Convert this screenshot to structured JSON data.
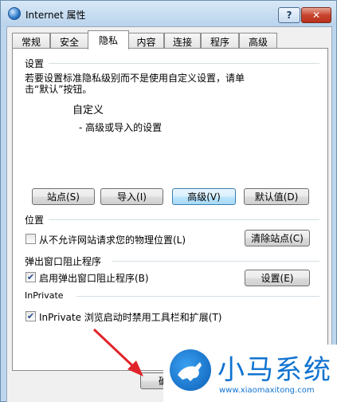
{
  "window": {
    "title": "Internet 属性",
    "help_label": "?",
    "close_label": "✕"
  },
  "tabs": [
    {
      "label": "常规"
    },
    {
      "label": "安全"
    },
    {
      "label": "隐私"
    },
    {
      "label": "内容"
    },
    {
      "label": "连接"
    },
    {
      "label": "程序"
    },
    {
      "label": "高级"
    }
  ],
  "active_tab": "隐私",
  "settings": {
    "heading": "设置",
    "description_line1": "若要设置标准隐私级别而不是使用自定义设置，请单",
    "description_line2": "击“默认”按钮。",
    "level": "自定义",
    "level_detail": "- 高级或导入的设置"
  },
  "settings_buttons": {
    "sites": "站点(S)",
    "import": "导入(I)",
    "advanced": "高级(V)",
    "default": "默认值(D)"
  },
  "location": {
    "heading": "位置",
    "checkbox_label": "从不允许网站请求您的物理位置(L)",
    "checked": false,
    "clear_button": "清除站点(C)"
  },
  "popup": {
    "heading": "弹出窗口阻止程序",
    "checkbox_label": "启用弹出窗口阻止程序(B)",
    "checked": true,
    "settings_button": "设置(E)"
  },
  "inprivate": {
    "heading": "InPrivate",
    "checkbox_label": "InPrivate 浏览启动时禁用工具栏和扩展(T)",
    "checked": true
  },
  "footer": {
    "ok_button": "确定"
  },
  "watermark": {
    "title": "小马系统",
    "url": "www.xiaomaxitong.com"
  },
  "colors": {
    "arrow": "#e0242a",
    "watermark": "#1073d1"
  }
}
